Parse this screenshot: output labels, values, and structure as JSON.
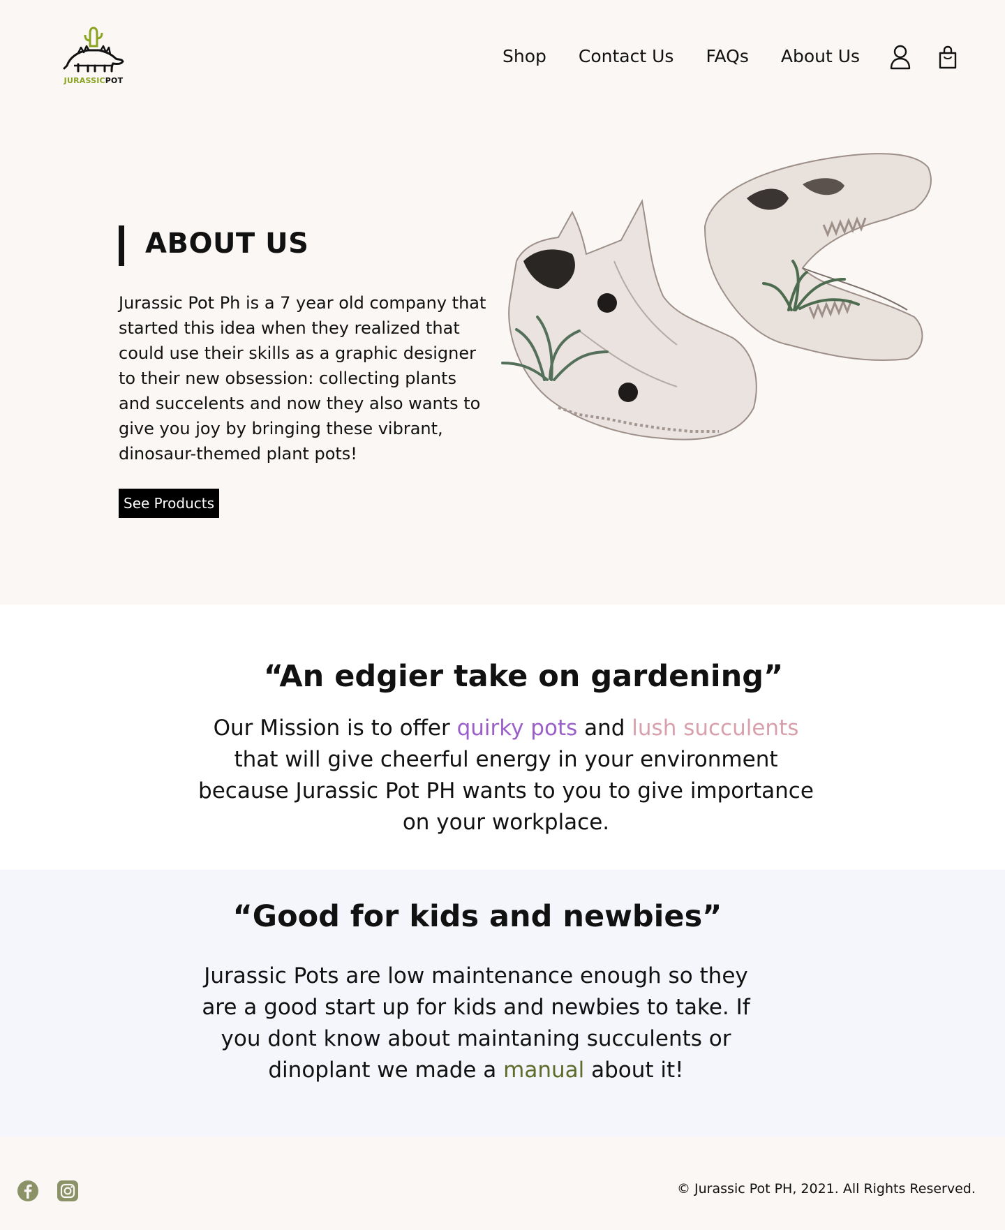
{
  "brand": {
    "logo_text_1": "JURASSIC",
    "logo_text_2": "POT",
    "accent": "#8aa420"
  },
  "nav": {
    "items": [
      "Shop",
      "Contact Us",
      "FAQs",
      "About Us"
    ]
  },
  "header_icons": [
    "user-icon",
    "shopping-bag-icon"
  ],
  "hero": {
    "title": "ABOUT US",
    "text": "Jurassic Pot Ph is a 7 year old company that\nstarted this idea when they realized that\ncould use their skills as a graphic designer\nto their new  obsession: collecting plants\nand succelents and now they also wants to\ngive you joy by bringing these vibrant,\ndinosaur-themed plant pots!",
    "button": "See Products"
  },
  "mission": {
    "title": "“An edgier take on gardening”",
    "p1": "Our Mission is to offer ",
    "hl1": "quirky pots",
    "p2": " and ",
    "hl2": "lush succulents",
    "p3": " that will give cheerful energy in your environment because Jurassic Pot PH wants to you to give importance on your workplace.",
    "colors": {
      "quirky": "#9a5fc9",
      "lush": "#d8a0ac"
    }
  },
  "kids": {
    "title": "“Good for kids and newbies”",
    "p1": "Jurassic Pots are low maintenance enough so they are a good start up for kids and newbies to take. If you dont know about maintaning succulents or dinoplant we made a ",
    "link": "manual",
    "p2": " about it!",
    "link_color": "#5d6b2b"
  },
  "footer": {
    "social_icons": [
      "facebook-icon",
      "instagram-icon"
    ],
    "social_color": "#8b9268",
    "copyright": "© Jurassic Pot PH, 2021. All Rights Reserved."
  }
}
